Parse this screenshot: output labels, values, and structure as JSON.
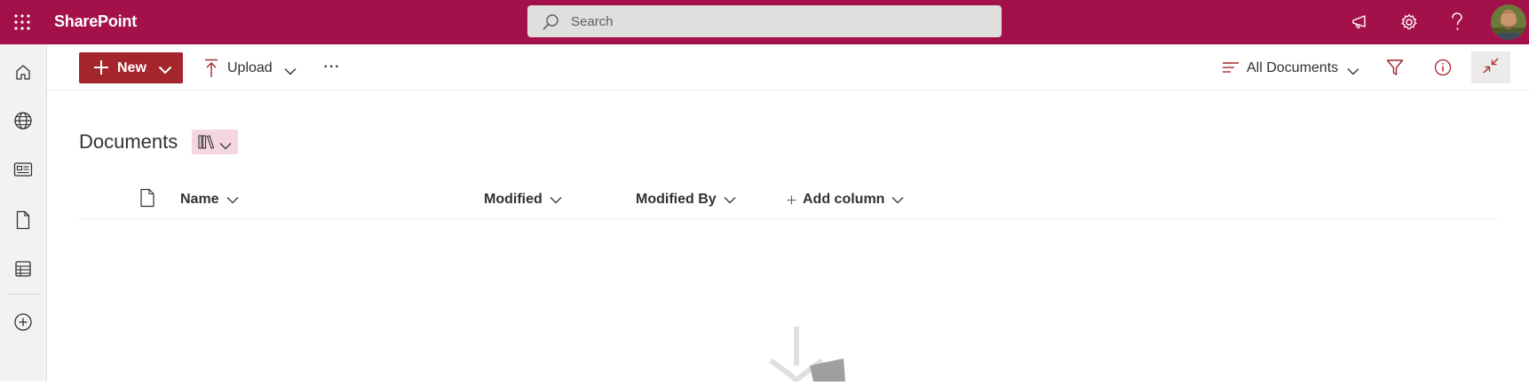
{
  "app": {
    "title": "SharePoint"
  },
  "search": {
    "placeholder": "Search"
  },
  "suite": {
    "icons": [
      "waffle-icon",
      "megaphone-icon",
      "gear-icon",
      "help-icon"
    ],
    "avatar": "user-avatar"
  },
  "leftnav": {
    "items": [
      "home-icon",
      "globe-icon",
      "news-icon",
      "document-icon",
      "list-icon",
      "add-circle-icon"
    ]
  },
  "commands": {
    "new_label": "New",
    "upload_label": "Upload",
    "more_label": "···",
    "view_label": "All Documents"
  },
  "library": {
    "title": "Documents"
  },
  "columns": {
    "name": "Name",
    "modified": "Modified",
    "modified_by": "Modified By",
    "add_column": "Add column"
  },
  "colors": {
    "brand": "#a4114a",
    "primary_button": "#a4262c",
    "accent_tint": "#f4d6df"
  }
}
